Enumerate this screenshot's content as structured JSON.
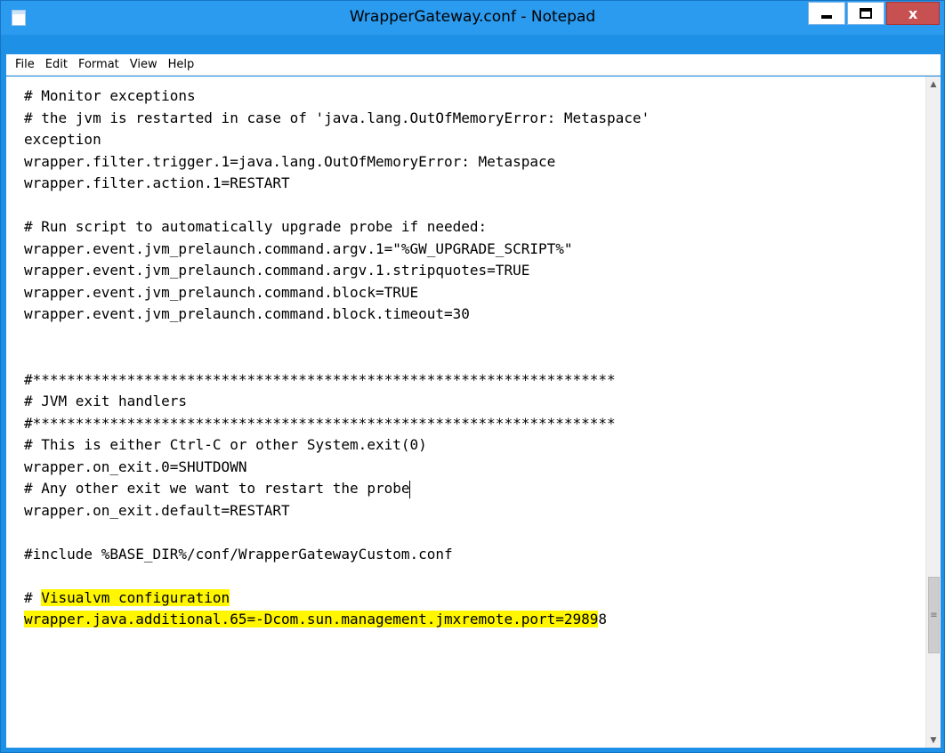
{
  "window": {
    "title": "WrapperGateway.conf - Notepad",
    "accent_color": "#2b9bf0",
    "close_color": "#c75050",
    "highlight_color": "#fff600",
    "controls": {
      "minimize_icon": "minimize-icon",
      "maximize_icon": "maximize-icon",
      "close_label": "x"
    }
  },
  "menu": [
    "File",
    "Edit",
    "Format",
    "View",
    "Help"
  ],
  "editor": {
    "lines": [
      "# Monitor exceptions",
      "# the jvm is restarted in case of 'java.lang.OutOfMemoryError: Metaspace'",
      "exception",
      "wrapper.filter.trigger.1=java.lang.OutOfMemoryError: Metaspace",
      "wrapper.filter.action.1=RESTART",
      "",
      "# Run script to automatically upgrade probe if needed:",
      "wrapper.event.jvm_prelaunch.command.argv.1=\"%GW_UPGRADE_SCRIPT%\"",
      "wrapper.event.jvm_prelaunch.command.argv.1.stripquotes=TRUE",
      "wrapper.event.jvm_prelaunch.command.block=TRUE",
      "wrapper.event.jvm_prelaunch.command.block.timeout=30",
      "",
      "",
      "#********************************************************************",
      "# JVM exit handlers",
      "#********************************************************************",
      "# This is either Ctrl-C or other System.exit(0)",
      "wrapper.on_exit.0=SHUTDOWN",
      "# Any other exit we want to restart the probe",
      "wrapper.on_exit.default=RESTART",
      "",
      "#include %BASE_DIR%/conf/WrapperGatewayCustom.conf",
      "",
      "# Visualvm configuration",
      "wrapper.java.additional.65=-Dcom.sun.management.jmxremote.port=29898"
    ],
    "caret_line": 18,
    "highlight": {
      "23": {
        "plain_prefix": "# ",
        "marked": "Visualvm configuration",
        "plain_suffix": ""
      },
      "24": {
        "plain_prefix": "",
        "marked": "wrapper.java.additional.65=-Dcom.sun.management.jmxremote.port=2989",
        "plain_suffix": "8"
      }
    }
  },
  "scrollbar": {
    "position": 0.86
  }
}
